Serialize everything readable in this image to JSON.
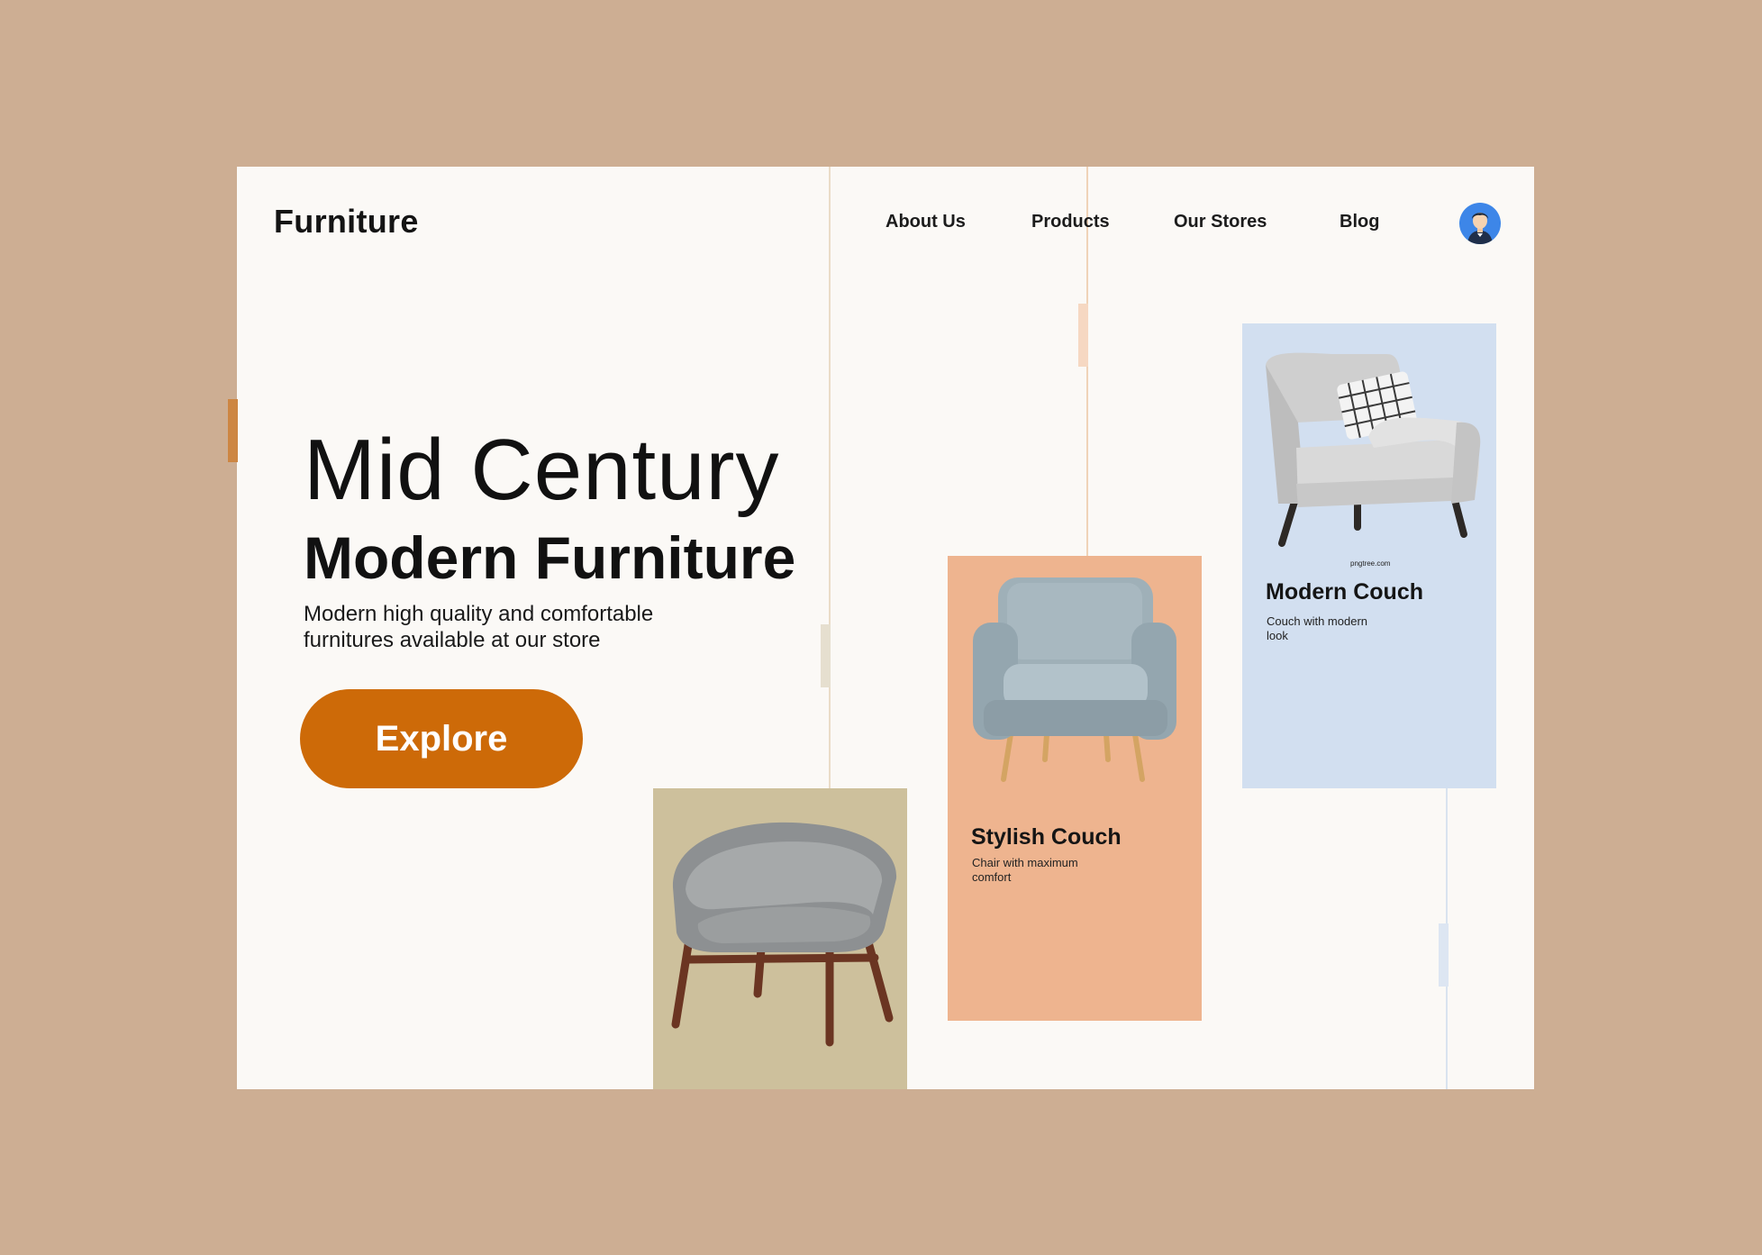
{
  "brand": {
    "logo_text": "Furniture"
  },
  "nav": {
    "items": [
      {
        "label": "About Us"
      },
      {
        "label": "Products"
      },
      {
        "label": "Our Stores"
      },
      {
        "label": "Blog"
      }
    ]
  },
  "hero": {
    "title_line1": "Mid Century",
    "title_line2": "Modern Furniture",
    "subtitle": "Modern high quality and comfortable furnitures available at our store",
    "cta_label": "Explore"
  },
  "cards": {
    "stylish": {
      "title": "Stylish Couch",
      "description": "Chair with maximum comfort"
    },
    "modern": {
      "title": "Modern Couch",
      "description": "Couch with modern look",
      "watermark": "pngtree.com"
    }
  },
  "colors": {
    "outer_background": "#cdae93",
    "page_background": "#fbf9f6",
    "accent_orange": "#cd6a08",
    "card_beige": "#cdc09c",
    "card_peach": "#eeb48f",
    "card_blue": "#d2dff0"
  },
  "icons": {
    "avatar": "user-avatar-icon"
  }
}
